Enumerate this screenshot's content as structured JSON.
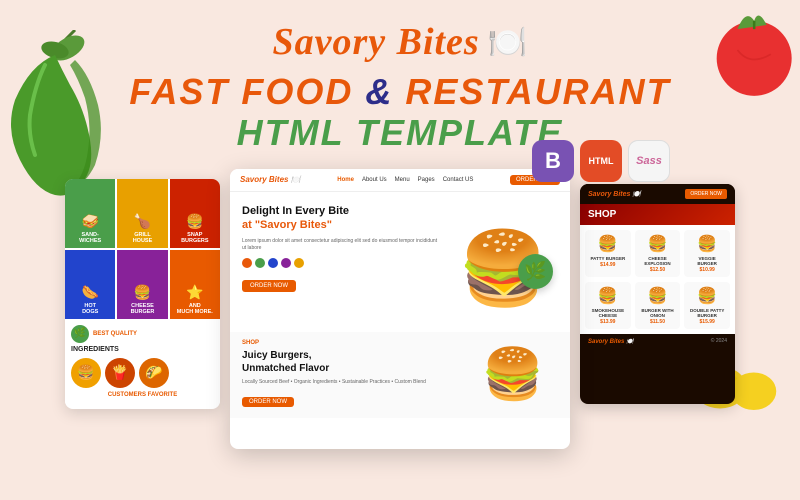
{
  "logo": {
    "text": "Savory Bites",
    "icon": "🍽️"
  },
  "tagline": {
    "line1_part1": "FAST FOOD",
    "line1_connector": " & ",
    "line1_part2": "RESTAURANT",
    "line2": "HTML TEMPLATE"
  },
  "tech_badges": [
    {
      "name": "Bootstrap",
      "symbol": "B",
      "color": "#7952b3"
    },
    {
      "name": "HTML",
      "symbol": "HTML",
      "color": "#e34c26"
    },
    {
      "name": "Sass",
      "symbol": "Sass",
      "color": "#cc6699"
    }
  ],
  "preview_left": {
    "categories": [
      {
        "label": "SAND-WICHES",
        "color": "green"
      },
      {
        "label": "GRILL HOUSE",
        "color": "yellow"
      },
      {
        "label": "SNAP BURGERS",
        "color": "red"
      },
      {
        "label": "HOT DOGS",
        "color": "blue"
      },
      {
        "label": "CHEESE BURGER",
        "color": "purple"
      },
      {
        "label": "AND MUCH MORE...",
        "color": "orange"
      }
    ],
    "section_title": "BEST QUALITY INGREDIENTS",
    "sub_title": "CUSTOMERS FAVORITE"
  },
  "preview_center": {
    "nav": {
      "logo": "Savory Bites",
      "links": [
        "Home",
        "About Us",
        "Menu",
        "Pages",
        "Contact US"
      ],
      "cta": "ORDER NOW"
    },
    "hero": {
      "heading_line1": "Delight In Every Bite",
      "heading_line2": "at \"Savory Bites\"",
      "sub_text": "Lorem ipsum dolor sit amet consectetur adipiscing elit sed do eiusmod tempor incididunt ut labore",
      "cta": "ORDER NOW"
    },
    "section2": {
      "label": "SHOP",
      "heading_line1": "Juicy Burgers,",
      "heading_line2": "Unmatched Flavor",
      "sub_text": "Locally Sourced Beef • Organic Ingredients • Sustainable Practices • Custom Blend",
      "cta": "ORDER NOW"
    }
  },
  "preview_right": {
    "logo": "Savory Bites",
    "cta": "ORDER NOW",
    "shop_title": "SHOP",
    "products": [
      {
        "name": "PATTY BURGER",
        "price": "$14.99",
        "emoji": "🍔"
      },
      {
        "name": "CHEESE EXPLOSION",
        "price": "$12.50",
        "emoji": "🍔"
      },
      {
        "name": "VEGGIE BURGER",
        "price": "$10.99",
        "emoji": "🍔"
      },
      {
        "name": "SMOKEHOUSE CHEESE",
        "price": "$13.99",
        "emoji": "🍔"
      },
      {
        "name": "BURGER WITH ONION",
        "price": "$11.50",
        "emoji": "🍔"
      },
      {
        "name": "DOUBLE PATTY BURGER",
        "price": "$15.99",
        "emoji": "🍔"
      }
    ]
  },
  "decorative": {
    "pepper_emoji": "🌶️",
    "tomato_emoji": "🍅",
    "lemon_emoji": "🍋",
    "burger_emoji": "🍔"
  }
}
